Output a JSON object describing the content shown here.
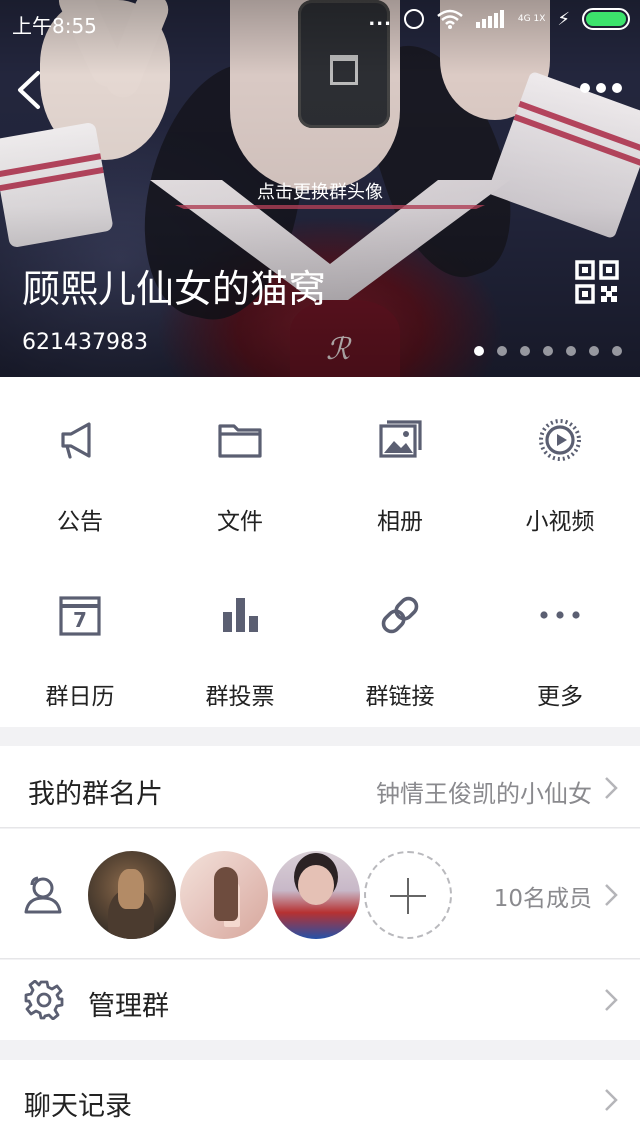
{
  "status_bar": {
    "time": "上午8:55",
    "dots": "...",
    "network": "4G 1X",
    "charge": "⚡"
  },
  "header": {
    "change_avatar_hint": "点击更换群头像",
    "group_name": "顾熙儿仙女的猫窝",
    "group_id": "621437983",
    "pager": {
      "count": 7,
      "active_index": 0
    }
  },
  "functions": [
    {
      "label": "公告",
      "icon": "megaphone-icon"
    },
    {
      "label": "文件",
      "icon": "folder-icon"
    },
    {
      "label": "相册",
      "icon": "photo-album-icon"
    },
    {
      "label": "小视频",
      "icon": "video-icon"
    },
    {
      "label": "群日历",
      "icon": "calendar-icon"
    },
    {
      "label": "群投票",
      "icon": "bar-chart-icon"
    },
    {
      "label": "群链接",
      "icon": "link-icon"
    },
    {
      "label": "更多",
      "icon": "more-dots-icon"
    }
  ],
  "calendar_day": "7",
  "my_card": {
    "title": "我的群名片",
    "value": "钟情王俊凯的小仙女"
  },
  "members": {
    "count_label": "10名成员"
  },
  "manage": {
    "title": "管理群"
  },
  "history": {
    "title": "聊天记录"
  },
  "colors": {
    "icon": "#5b5f72",
    "divider": "#e6e6e8",
    "battery": "#3ce36c",
    "secondary_text": "#8a8a8e"
  }
}
